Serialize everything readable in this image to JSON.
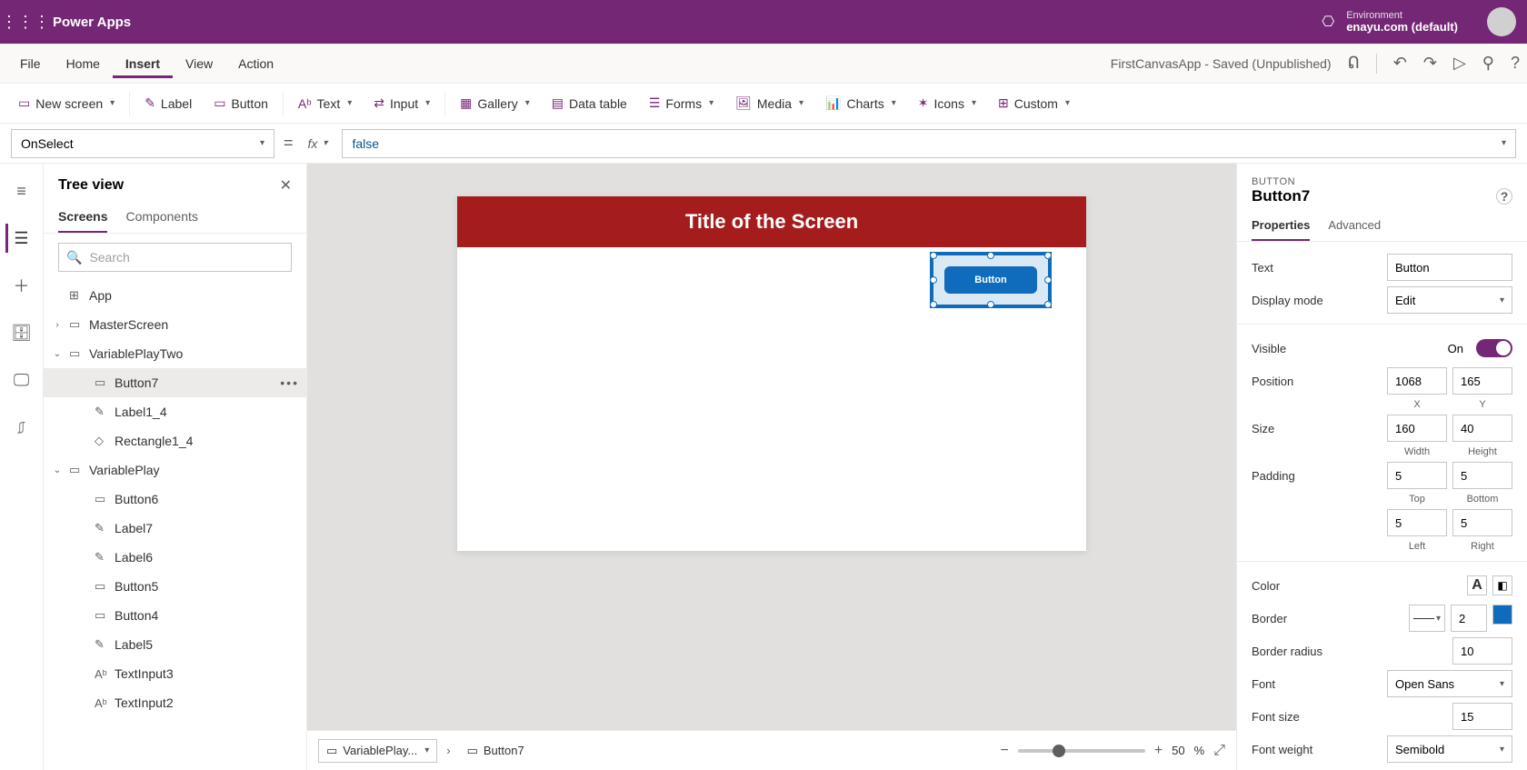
{
  "header": {
    "app_title": "Power Apps",
    "env_label": "Environment",
    "env_name": "enayu.com (default)"
  },
  "menu": {
    "items": [
      "File",
      "Home",
      "Insert",
      "View",
      "Action"
    ],
    "active_index": 2,
    "doc_status": "FirstCanvasApp - Saved (Unpublished)"
  },
  "ribbon": {
    "new_screen": "New screen",
    "label": "Label",
    "button": "Button",
    "text": "Text",
    "input": "Input",
    "gallery": "Gallery",
    "data_table": "Data table",
    "forms": "Forms",
    "media": "Media",
    "charts": "Charts",
    "icons": "Icons",
    "custom": "Custom"
  },
  "formula": {
    "property": "OnSelect",
    "value": "false"
  },
  "tree": {
    "title": "Tree view",
    "tabs": [
      "Screens",
      "Components"
    ],
    "active_tab": 0,
    "search_placeholder": "Search",
    "app_label": "App",
    "items": [
      {
        "label": "MasterScreen",
        "depth": 1,
        "expand": "closed",
        "icon": "screen"
      },
      {
        "label": "VariablePlayTwo",
        "depth": 1,
        "expand": "open",
        "icon": "screen"
      },
      {
        "label": "Button7",
        "depth": 2,
        "icon": "button",
        "selected": true
      },
      {
        "label": "Label1_4",
        "depth": 2,
        "icon": "label"
      },
      {
        "label": "Rectangle1_4",
        "depth": 2,
        "icon": "rect"
      },
      {
        "label": "VariablePlay",
        "depth": 1,
        "expand": "open",
        "icon": "screen"
      },
      {
        "label": "Button6",
        "depth": 2,
        "icon": "button"
      },
      {
        "label": "Label7",
        "depth": 2,
        "icon": "label"
      },
      {
        "label": "Label6",
        "depth": 2,
        "icon": "label"
      },
      {
        "label": "Button5",
        "depth": 2,
        "icon": "button"
      },
      {
        "label": "Button4",
        "depth": 2,
        "icon": "button"
      },
      {
        "label": "Label5",
        "depth": 2,
        "icon": "label"
      },
      {
        "label": "TextInput3",
        "depth": 2,
        "icon": "input"
      },
      {
        "label": "TextInput2",
        "depth": 2,
        "icon": "input"
      }
    ]
  },
  "canvas": {
    "screen_title": "Title of the Screen",
    "button_label": "Button",
    "breadcrumb_screen": "VariablePlay...",
    "breadcrumb_control": "Button7",
    "zoom_value": "50",
    "zoom_unit": "%"
  },
  "props_panel": {
    "type_label": "BUTTON",
    "control_name": "Button7",
    "tabs": [
      "Properties",
      "Advanced"
    ],
    "active_tab": 0,
    "labels": {
      "text": "Text",
      "display_mode": "Display mode",
      "visible": "Visible",
      "position": "Position",
      "size": "Size",
      "padding": "Padding",
      "color": "Color",
      "border": "Border",
      "border_radius": "Border radius",
      "font": "Font",
      "font_size": "Font size",
      "font_weight": "Font weight",
      "x": "X",
      "y": "Y",
      "width": "Width",
      "height": "Height",
      "top": "Top",
      "bottom": "Bottom",
      "left": "Left",
      "right": "Right",
      "visible_on": "On"
    },
    "values": {
      "text": "Button",
      "display_mode": "Edit",
      "pos_x": "1068",
      "pos_y": "165",
      "width": "160",
      "height": "40",
      "pad_top": "5",
      "pad_bottom": "5",
      "pad_left": "5",
      "pad_right": "5",
      "border_width": "2",
      "border_radius": "10",
      "font": "Open Sans",
      "font_size": "15",
      "font_weight": "Semibold",
      "border_color": "#0f6cbd",
      "text_color_fg": "#323130"
    }
  }
}
